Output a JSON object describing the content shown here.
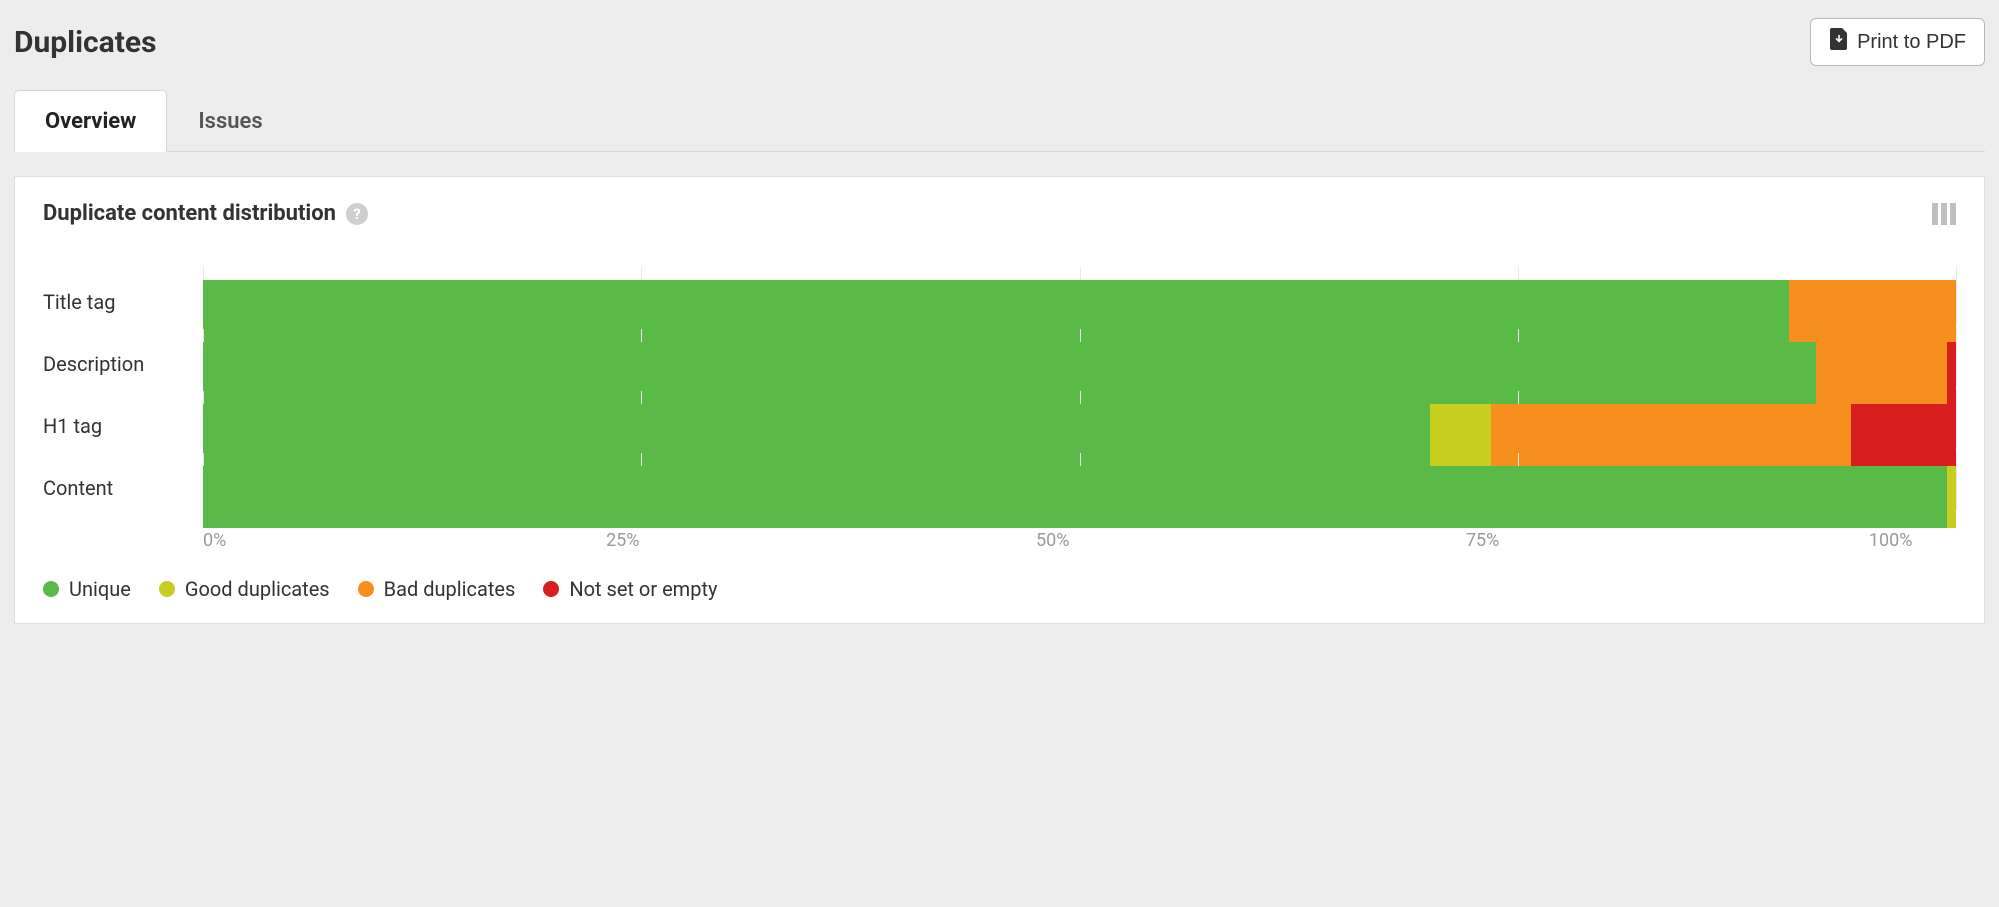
{
  "header": {
    "title": "Duplicates",
    "print_btn": "Print to PDF"
  },
  "tabs": [
    {
      "label": "Overview",
      "active": true
    },
    {
      "label": "Issues",
      "active": false
    }
  ],
  "section": {
    "title": "Duplicate content distribution"
  },
  "axis": {
    "ticks": [
      "0%",
      "25%",
      "50%",
      "75%",
      "100%"
    ]
  },
  "legend": {
    "unique": "Unique",
    "good": "Good duplicates",
    "bad": "Bad duplicates",
    "empty": "Not set or empty"
  },
  "colors": {
    "unique": "#5aba47",
    "good": "#c8ce1f",
    "bad": "#f78f1e",
    "empty": "#d81f1f"
  },
  "chart_data": {
    "type": "bar",
    "orientation": "horizontal",
    "stacked": true,
    "title": "Duplicate content distribution",
    "xlabel": "",
    "ylabel": "",
    "xlim": [
      0,
      100
    ],
    "x_ticks": [
      0,
      25,
      50,
      75,
      100
    ],
    "categories": [
      "Title tag",
      "Description",
      "H1 tag",
      "Content"
    ],
    "series": [
      {
        "name": "Unique",
        "key": "unique",
        "color": "#5aba47",
        "values": [
          90.5,
          92.0,
          70.0,
          99.5
        ]
      },
      {
        "name": "Good duplicates",
        "key": "good",
        "color": "#c8ce1f",
        "values": [
          0.0,
          0.0,
          3.5,
          0.5
        ]
      },
      {
        "name": "Bad duplicates",
        "key": "bad",
        "color": "#f78f1e",
        "values": [
          9.5,
          7.5,
          20.5,
          0.0
        ]
      },
      {
        "name": "Not set or empty",
        "key": "empty",
        "color": "#d81f1f",
        "values": [
          0.0,
          0.5,
          6.0,
          0.0
        ]
      }
    ]
  }
}
